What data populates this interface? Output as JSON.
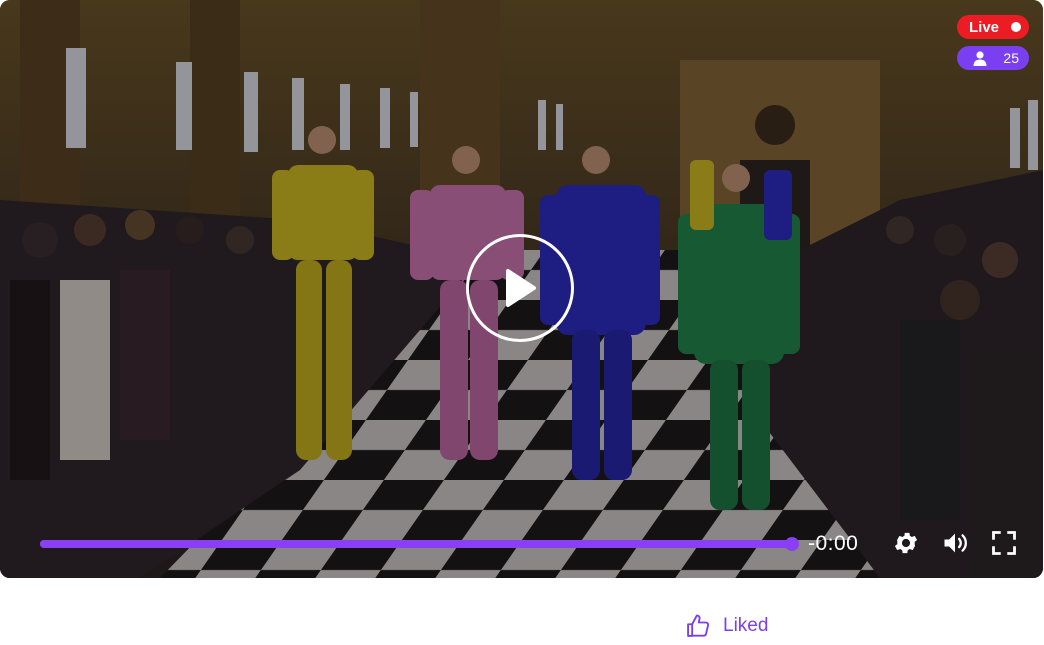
{
  "player": {
    "live_label": "Live",
    "viewer_count": "25",
    "progress_fraction": 1.0,
    "time_remaining": "-0:00",
    "accent_color": "#8a3ff5",
    "live_color": "#ec1c24",
    "icons": {
      "play": "play-icon",
      "settings": "gear-icon",
      "volume": "speaker-icon",
      "fullscreen": "fullscreen-icon",
      "viewers": "user-icon",
      "live": "record-dot-icon"
    }
  },
  "reactions": {
    "liked_label": "Liked",
    "icon": "thumbs-up-icon",
    "color": "#7b3ff2"
  }
}
